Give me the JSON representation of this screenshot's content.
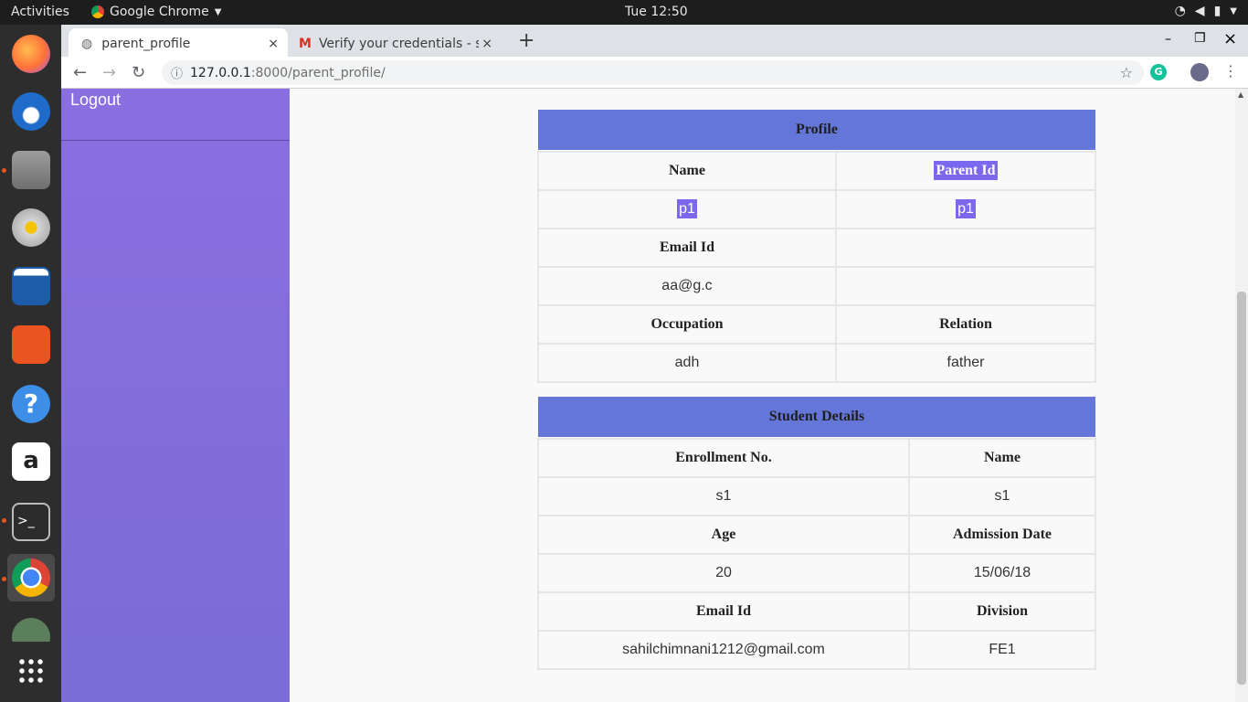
{
  "topbar": {
    "activities": "Activities",
    "app": "Google Chrome",
    "clock": "Tue 12:50"
  },
  "tabs": [
    {
      "title": "parent_profile",
      "close": "×"
    },
    {
      "title": "Verify your credentials - sa",
      "close": "×"
    }
  ],
  "newtab": "+",
  "window": {
    "min": "–",
    "max": "❐",
    "close": "×"
  },
  "url": {
    "host": "127.0.0.1",
    "path": ":8000/parent_profile/"
  },
  "sidebar": {
    "logout": "Logout"
  },
  "profile": {
    "title": "Profile",
    "rows": [
      [
        "Name",
        "Parent Id"
      ],
      [
        "p1",
        "p1"
      ],
      [
        "Email Id",
        ""
      ],
      [
        "aa@g.c",
        ""
      ],
      [
        "Occupation",
        "Relation"
      ],
      [
        "adh",
        "father"
      ]
    ]
  },
  "student": {
    "title": "Student Details",
    "rows": [
      [
        "Enrollment No.",
        "Name"
      ],
      [
        "s1",
        "s1"
      ],
      [
        "Age",
        "Admission Date"
      ],
      [
        "20",
        "15/06/18"
      ],
      [
        "Email Id",
        "Division"
      ],
      [
        "sahilchimnani1212@gmail.com",
        "FE1"
      ]
    ]
  },
  "colors": {
    "accent": "#6477d9",
    "sidebar": "#7b6cd6",
    "selection": "#7b68ee"
  }
}
